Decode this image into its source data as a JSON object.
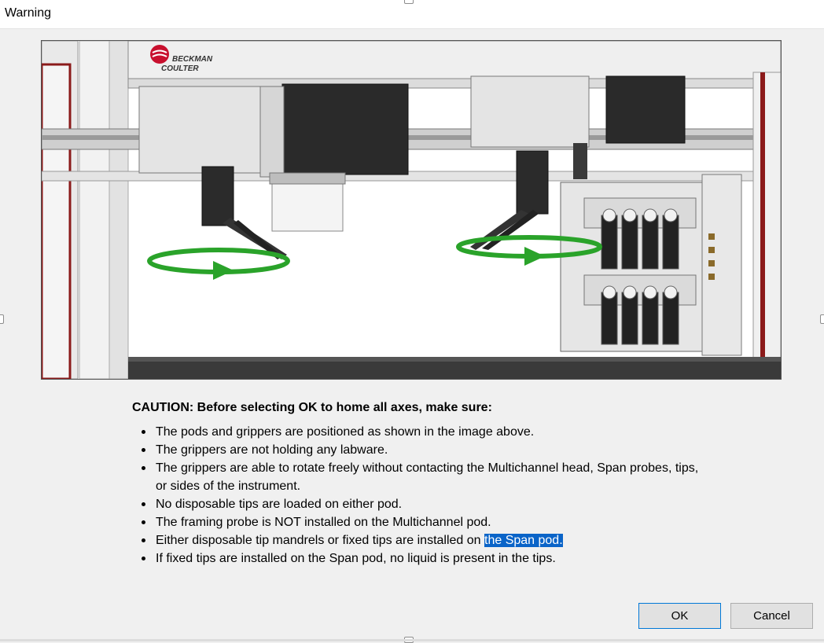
{
  "window": {
    "title": "Warning"
  },
  "image": {
    "brand_line1": "BECKMAN",
    "brand_line2": "COULTER",
    "colors": {
      "arrow": "#2aa32a",
      "brand_red": "#c8102e",
      "frame_red": "#8b1a1a"
    }
  },
  "caution": {
    "heading": "CAUTION: Before selecting OK to home all axes, make sure:",
    "items": [
      "The pods and grippers are positioned as shown in the image above.",
      "The grippers are not holding any labware.",
      "The grippers are able to rotate freely without contacting the Multichannel head, Span probes, tips, or sides of the instrument.",
      "No disposable tips are loaded on either pod.",
      "The framing probe is NOT installed on the Multichannel pod."
    ],
    "item6_prefix": "Either disposable tip mandrels or fixed tips are installed on ",
    "item6_selected": "the Span pod.",
    "item7": "If fixed tips are installed on the Span pod, no liquid is present in the tips.",
    "selection_color": "#0a64c8"
  },
  "buttons": {
    "ok_label": "OK",
    "cancel_label": "Cancel"
  }
}
